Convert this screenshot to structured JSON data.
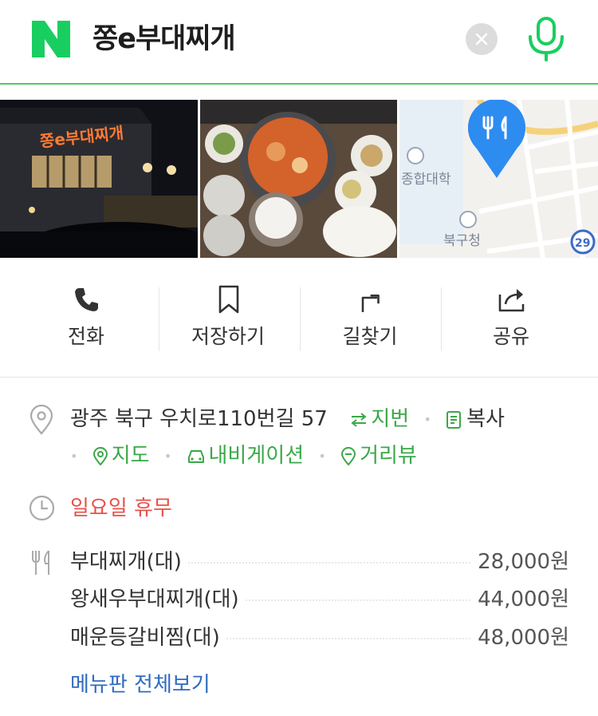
{
  "search": {
    "query": "쫑e부대찌개",
    "logo_letter": "N"
  },
  "photos": [
    {
      "alt": "restaurant-exterior-night",
      "sign_text": "쫑e부대찌개"
    },
    {
      "alt": "budae-jjigae-table"
    },
    {
      "alt": "map-thumbnail",
      "map_labels": [
        "종합대학",
        "북구청",
        "29"
      ]
    }
  ],
  "actions": [
    {
      "label": "전화",
      "icon": "phone-icon"
    },
    {
      "label": "저장하기",
      "icon": "bookmark-icon"
    },
    {
      "label": "길찾기",
      "icon": "directions-icon"
    },
    {
      "label": "공유",
      "icon": "share-icon"
    }
  ],
  "address": {
    "text": "광주 북구 우치로110번길 57",
    "jibun_label": "지번",
    "copy_label": "복사",
    "map_label": "지도",
    "navigation_label": "내비게이션",
    "streetview_label": "거리뷰"
  },
  "hours": {
    "text": "일요일 휴무"
  },
  "menu": {
    "items": [
      {
        "name": "부대찌개(대)",
        "price": "28,000원"
      },
      {
        "name": "왕새우부대찌개(대)",
        "price": "44,000원"
      },
      {
        "name": "매운등갈비찜(대)",
        "price": "48,000원"
      }
    ],
    "more_label": "메뉴판 전체보기"
  },
  "colors": {
    "brand_green": "#03c75a",
    "link_green": "#3aa848",
    "closed_red": "#e5524b",
    "link_blue": "#2f6bc0",
    "map_pin_blue": "#2d8cf0"
  }
}
